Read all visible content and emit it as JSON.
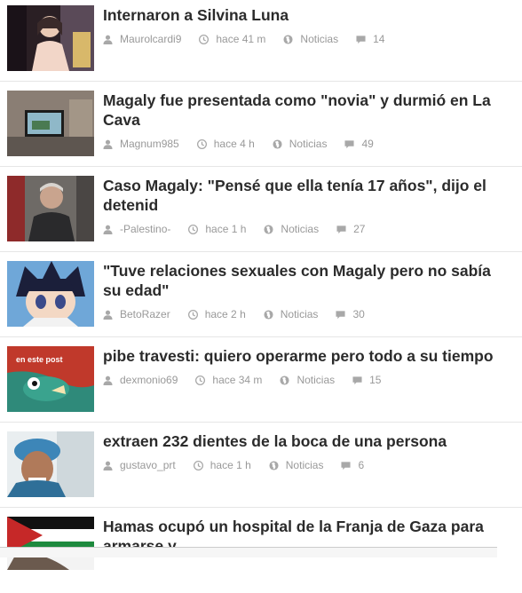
{
  "posts": [
    {
      "title": "Internaron a Silvina Luna",
      "author": "Maurolcardi9",
      "time": "hace 41 m",
      "category": "Noticias",
      "comments": "14"
    },
    {
      "title": "Magaly fue presentada como \"novia\" y durmió en La Cava",
      "author": "Magnum985",
      "time": "hace 4 h",
      "category": "Noticias",
      "comments": "49"
    },
    {
      "title": "Caso Magaly: \"Pensé que ella tenía 17 años\", dijo el detenid",
      "author": "-Palestino-",
      "time": "hace 1 h",
      "category": "Noticias",
      "comments": "27"
    },
    {
      "title": "\"Tuve relaciones sexuales con Magaly pero no sabía su edad\"",
      "author": "BetoRazer",
      "time": "hace 2 h",
      "category": "Noticias",
      "comments": "30"
    },
    {
      "title": "pibe travesti: quiero operarme pero todo a su tiempo",
      "author": "dexmonio69",
      "time": "hace 34 m",
      "category": "Noticias",
      "comments": "15",
      "thumb_text": "en este post"
    },
    {
      "title": "extraen 232 dientes de la boca de una persona",
      "author": "gustavo_prt",
      "time": "hace 1 h",
      "category": "Noticias",
      "comments": "6"
    },
    {
      "title": "Hamas ocupó un hospital de la Franja de Gaza para armarse y",
      "author": "",
      "time": "",
      "category": "",
      "comments": ""
    }
  ],
  "icons": {
    "user": "user-icon",
    "clock": "clock-icon",
    "category": "globe-icon",
    "comments": "comment-icon"
  }
}
